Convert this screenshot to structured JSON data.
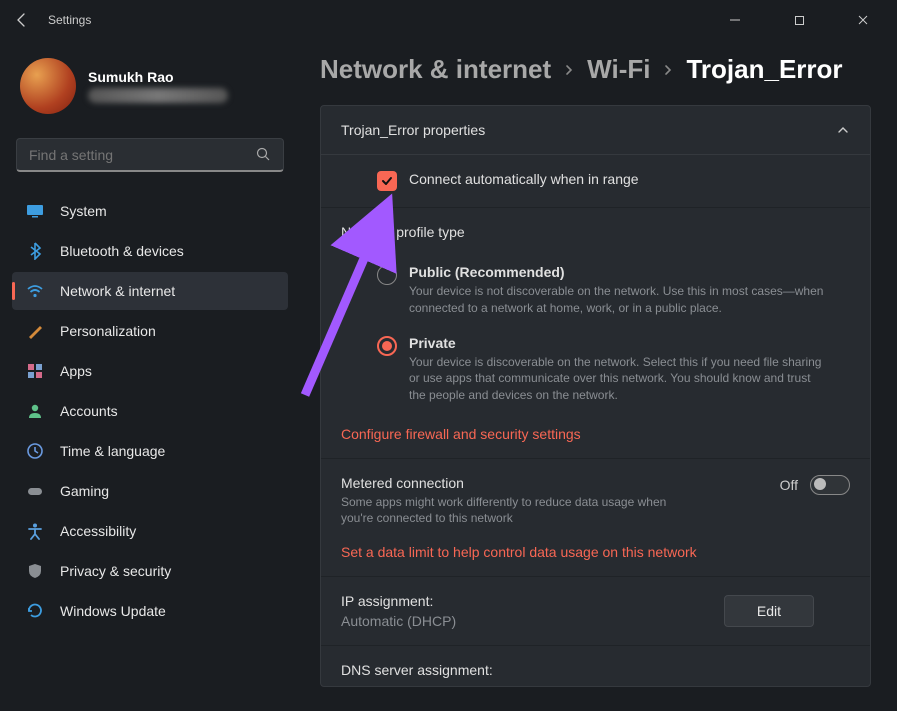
{
  "titlebar": {
    "app": "Settings"
  },
  "profile": {
    "name": "Sumukh Rao"
  },
  "search": {
    "placeholder": "Find a setting"
  },
  "nav": [
    {
      "key": "system",
      "label": "System",
      "icon": "monitor",
      "color": "#3d9de0"
    },
    {
      "key": "bluetooth",
      "label": "Bluetooth & devices",
      "icon": "bluetooth",
      "color": "#3d9de0"
    },
    {
      "key": "network",
      "label": "Network & internet",
      "icon": "wifi",
      "color": "#3d9de0",
      "selected": true
    },
    {
      "key": "personalization",
      "label": "Personalization",
      "icon": "brush",
      "color": "#d48a3a"
    },
    {
      "key": "apps",
      "label": "Apps",
      "icon": "apps",
      "color": "#d46a8a"
    },
    {
      "key": "accounts",
      "label": "Accounts",
      "icon": "person",
      "color": "#5fc28a"
    },
    {
      "key": "time",
      "label": "Time & language",
      "icon": "clock",
      "color": "#6a9ae0"
    },
    {
      "key": "gaming",
      "label": "Gaming",
      "icon": "gamepad",
      "color": "#8a8e93"
    },
    {
      "key": "accessibility",
      "label": "Accessibility",
      "icon": "accessibility",
      "color": "#5aa0e0"
    },
    {
      "key": "privacy",
      "label": "Privacy & security",
      "icon": "shield",
      "color": "#8a8e93"
    },
    {
      "key": "update",
      "label": "Windows Update",
      "icon": "update",
      "color": "#3d9de0"
    }
  ],
  "breadcrumb": [
    {
      "label": "Network & internet",
      "current": false
    },
    {
      "label": "Wi-Fi",
      "current": false
    },
    {
      "label": "Trojan_Error",
      "current": true
    }
  ],
  "properties": {
    "header": "Trojan_Error properties",
    "connectAuto": {
      "label": "Connect automatically when in range",
      "checked": true
    },
    "profileType": {
      "title": "Network profile type",
      "options": [
        {
          "key": "public",
          "label": "Public (Recommended)",
          "desc": "Your device is not discoverable on the network. Use this in most cases—when connected to a network at home, work, or in a public place.",
          "checked": false
        },
        {
          "key": "private",
          "label": "Private",
          "desc": "Your device is discoverable on the network. Select this if you need file sharing or use apps that communicate over this network. You should know and trust the people and devices on the network.",
          "checked": true
        }
      ],
      "firewallLink": "Configure firewall and security settings"
    },
    "metered": {
      "title": "Metered connection",
      "desc": "Some apps might work differently to reduce data usage when you're connected to this network",
      "stateLabel": "Off",
      "dataLimitLink": "Set a data limit to help control data usage on this network"
    },
    "ip": {
      "label": "IP assignment:",
      "value": "Automatic (DHCP)",
      "button": "Edit"
    },
    "dns": {
      "label": "DNS server assignment:"
    }
  }
}
